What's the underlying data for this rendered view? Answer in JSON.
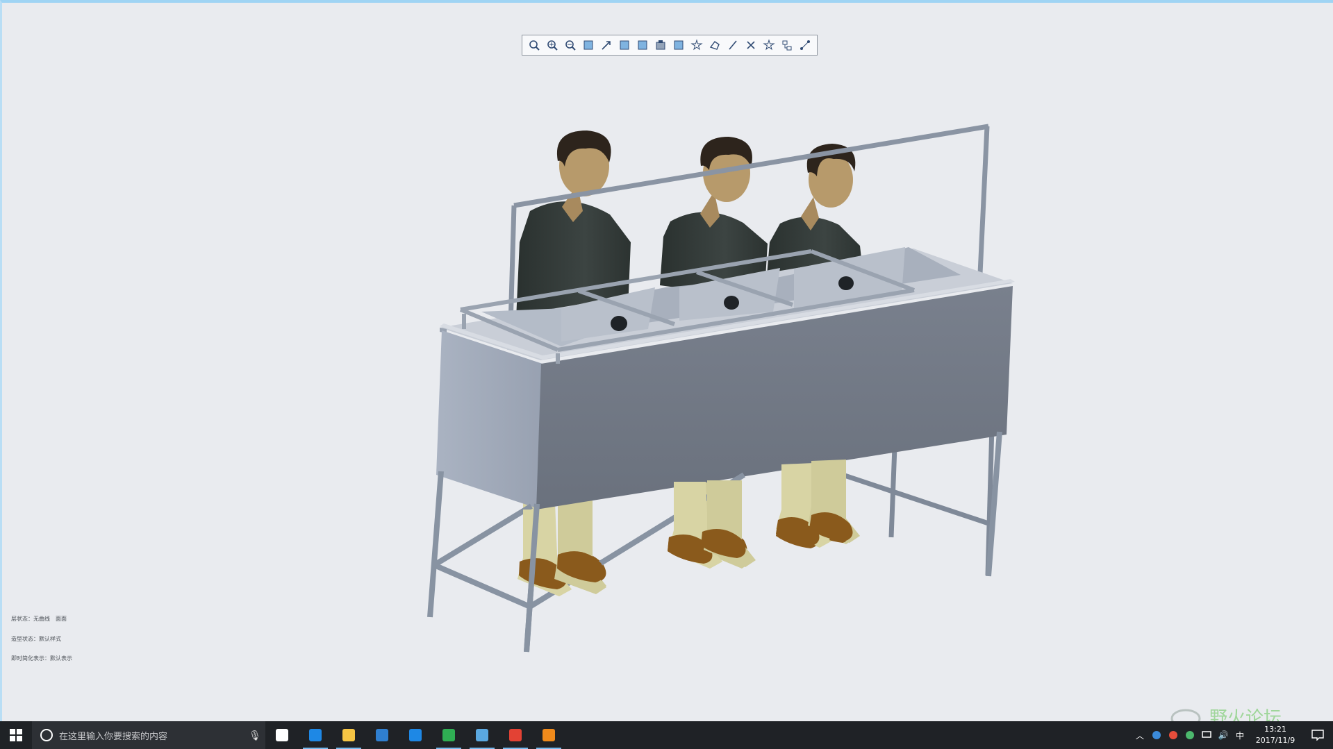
{
  "toolbar": {
    "buttons": [
      {
        "name": "refit-icon"
      },
      {
        "name": "zoom-in-icon"
      },
      {
        "name": "zoom-out-icon"
      },
      {
        "name": "repaint-icon"
      },
      {
        "name": "spin-center-icon"
      },
      {
        "name": "display-style-icon"
      },
      {
        "name": "saved-views-icon"
      },
      {
        "name": "view-manager-icon"
      },
      {
        "name": "perspective-icon"
      },
      {
        "name": "datum-display-icon"
      },
      {
        "name": "plane-display-icon"
      },
      {
        "name": "axis-display-icon"
      },
      {
        "name": "point-display-icon"
      },
      {
        "name": "csys-display-icon"
      },
      {
        "name": "annotation-display-icon"
      },
      {
        "name": "spin-axis-icon"
      }
    ]
  },
  "status": {
    "line1": "层状态：无曲线　面面",
    "line2": "造型状态：默认样式",
    "line3": "即时简化表示：默认表示"
  },
  "watermark": {
    "text": "野火论坛"
  },
  "taskbar": {
    "search_placeholder": "在这里输入你要搜索的内容",
    "apps": [
      {
        "name": "task-view-icon",
        "color": "#ffffff",
        "active": false
      },
      {
        "name": "edge-icon",
        "color": "#1e88e5",
        "active": true
      },
      {
        "name": "file-explorer-icon",
        "color": "#f6c544",
        "active": true
      },
      {
        "name": "store-icon",
        "color": "#2f7fd0",
        "active": false
      },
      {
        "name": "mail-app-icon",
        "color": "#1e88e5",
        "active": false
      },
      {
        "name": "ie-green-icon",
        "color": "#2fae53",
        "active": true
      },
      {
        "name": "creo-window-icon",
        "color": "#5aa8e0",
        "active": true
      },
      {
        "name": "qq-icon",
        "color": "#e34234",
        "active": true
      },
      {
        "name": "vlc-icon",
        "color": "#ef8a1b",
        "active": true
      }
    ],
    "time": "13:21",
    "date": "2017/11/9",
    "ime": "中"
  }
}
